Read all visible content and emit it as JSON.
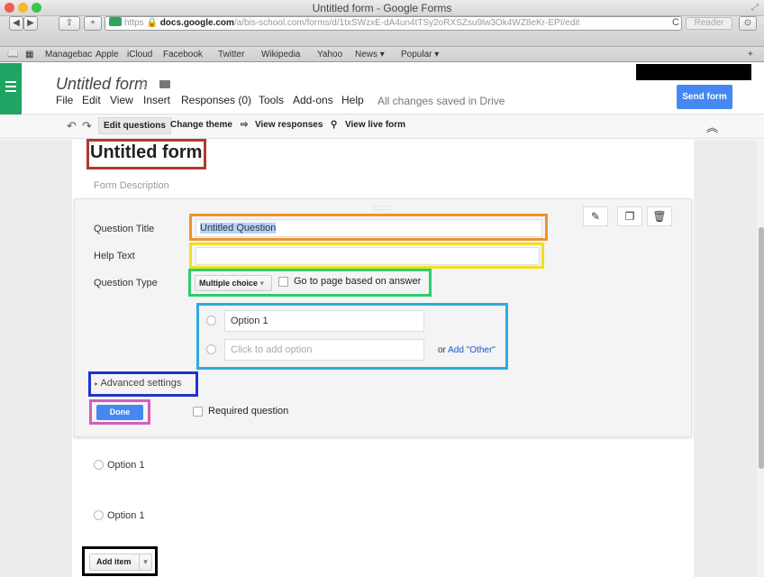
{
  "window": {
    "title": "Untitled form - Google Forms"
  },
  "browser": {
    "url_scheme": "https",
    "url_host": "docs.google.com",
    "url_path": "/a/bis-school.com/forms/d/1txSWzxE-dA4un4tTSy2oRXSZsu9lw3Ok4WZ8eKr-EPI/edit",
    "reader_label": "Reader",
    "bookmarks": [
      "Managebac",
      "Apple",
      "iCloud",
      "Facebook",
      "Twitter",
      "Wikipedia",
      "Yahoo",
      "News ▾",
      "Popular ▾"
    ]
  },
  "app": {
    "doc_title": "Untitled form",
    "menu": [
      "File",
      "Edit",
      "View",
      "Insert",
      "Responses (0)",
      "Tools",
      "Add-ons",
      "Help"
    ],
    "save_status": "All changes saved in Drive",
    "send_label": "Send form"
  },
  "edit_toolbar": {
    "edit_questions": "Edit questions",
    "change_theme": "Change theme",
    "view_responses": "View responses",
    "view_live": "View live form"
  },
  "form": {
    "title": "Untitled form",
    "description_placeholder": "Form Description",
    "question": {
      "title_label": "Question Title",
      "title_value": "Untitled Question",
      "help_label": "Help Text",
      "type_label": "Question Type",
      "type_value": "Multiple choice",
      "goto_label": "Go to page based on answer",
      "options": [
        "Option 1"
      ],
      "add_option_placeholder": "Click to add option",
      "or_text": "or",
      "add_other_label": "Add \"Other\"",
      "advanced_label": "Advanced settings",
      "done_label": "Done",
      "required_label": "Required question"
    },
    "preview_options": [
      "Option 1",
      "Option 1"
    ],
    "add_item_label": "Add item"
  },
  "annotation_colors": {
    "title": "#b03a2e",
    "question_title": "#f0912f",
    "help_text": "#f2de21",
    "question_type": "#2ecc71",
    "options": "#2fa9e0",
    "advanced": "#2034c9",
    "done": "#d35fb7",
    "add_item": "#000000"
  }
}
